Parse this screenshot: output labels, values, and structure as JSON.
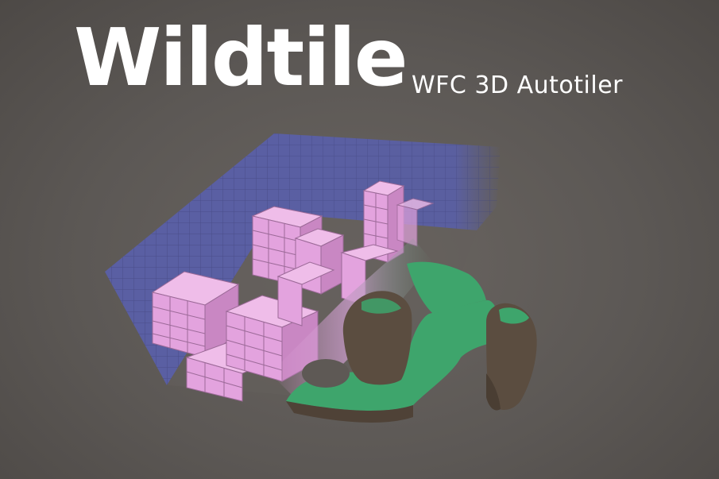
{
  "banner": {
    "title": "Wildtile",
    "subtitle": "WFC 3D Autotiler"
  },
  "colors": {
    "background": "#5c5855",
    "wall": "#5a5fa3",
    "grid_line": "#3f437c",
    "block": "#e3a3de",
    "block_edge": "#9c6a98",
    "grass": "#3ea56c",
    "rock": "#5b4d40"
  }
}
